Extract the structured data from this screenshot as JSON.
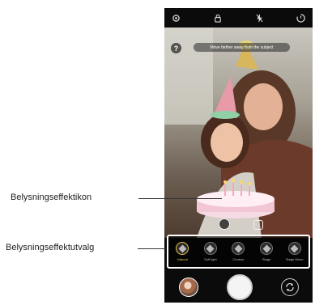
{
  "preview": {
    "help_glyph": "?",
    "hint_text": "Move farther away from the subject"
  },
  "lighting_effects": [
    {
      "label": "Natural",
      "selected": true
    },
    {
      "label": "Soft light",
      "selected": false
    },
    {
      "label": "Contour",
      "selected": false
    },
    {
      "label": "Stage",
      "selected": false
    },
    {
      "label": "Stage Mono",
      "selected": false
    }
  ],
  "callouts": {
    "lighting_icon": "Belysningseffektikon",
    "lighting_selection": "Belysningseffektutvalg"
  },
  "colors": {
    "selected_accent": "#f0c050",
    "strip_border": "#ffffff"
  },
  "icons": {
    "settings": "gear-icon",
    "lock": "lock-icon",
    "flash_off": "flash-off-icon",
    "timer": "timer-icon",
    "shutter": "shutter-button-icon",
    "switch_camera": "switch-camera-icon"
  }
}
